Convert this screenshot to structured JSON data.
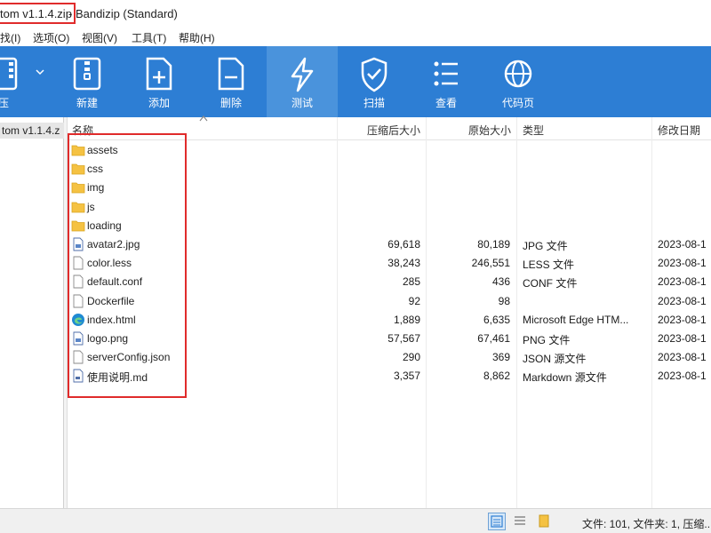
{
  "window": {
    "title_file": "tom v1.1.4.zip",
    "title_app": "- Bandizip (Standard)"
  },
  "menu": [
    {
      "label": "找(I)"
    },
    {
      "label": "选项(O)"
    },
    {
      "label": "视图(V)"
    },
    {
      "label": "工具(T)"
    },
    {
      "label": "帮助(H)"
    }
  ],
  "toolbar": {
    "extract_label": "压",
    "new_label": "新建",
    "add_label": "添加",
    "delete_label": "删除",
    "test_label": "测试",
    "scan_label": "扫描",
    "view_label": "查看",
    "codepage_label": "代码页"
  },
  "tree": {
    "root_label": "tom v1.1.4.z"
  },
  "columns": {
    "name": "名称",
    "compressed": "压缩后大小",
    "original": "原始大小",
    "type": "类型",
    "modified": "修改日期"
  },
  "files": [
    {
      "name": "assets",
      "icon": "folder-icon",
      "compressed": "",
      "original": "",
      "type": "",
      "date": ""
    },
    {
      "name": "css",
      "icon": "folder-icon",
      "compressed": "",
      "original": "",
      "type": "",
      "date": ""
    },
    {
      "name": "img",
      "icon": "folder-icon",
      "compressed": "",
      "original": "",
      "type": "",
      "date": ""
    },
    {
      "name": "js",
      "icon": "folder-icon",
      "compressed": "",
      "original": "",
      "type": "",
      "date": ""
    },
    {
      "name": "loading",
      "icon": "folder-icon",
      "compressed": "",
      "original": "",
      "type": "",
      "date": ""
    },
    {
      "name": "avatar2.jpg",
      "icon": "image-file-icon",
      "compressed": "69,618",
      "original": "80,189",
      "type": "JPG 文件",
      "date": "2023-08-1"
    },
    {
      "name": "color.less",
      "icon": "file-icon",
      "compressed": "38,243",
      "original": "246,551",
      "type": "LESS 文件",
      "date": "2023-08-1"
    },
    {
      "name": "default.conf",
      "icon": "file-icon",
      "compressed": "285",
      "original": "436",
      "type": "CONF 文件",
      "date": "2023-08-1"
    },
    {
      "name": "Dockerfile",
      "icon": "file-icon",
      "compressed": "92",
      "original": "98",
      "type": "",
      "date": "2023-08-1"
    },
    {
      "name": "index.html",
      "icon": "edge-icon",
      "compressed": "1,889",
      "original": "6,635",
      "type": "Microsoft Edge HTM...",
      "date": "2023-08-1"
    },
    {
      "name": "logo.png",
      "icon": "image-file-icon",
      "compressed": "57,567",
      "original": "67,461",
      "type": "PNG 文件",
      "date": "2023-08-1"
    },
    {
      "name": "serverConfig.json",
      "icon": "file-icon",
      "compressed": "290",
      "original": "369",
      "type": "JSON 源文件",
      "date": "2023-08-1"
    },
    {
      "name": "使用说明.md",
      "icon": "text-file-icon",
      "compressed": "3,357",
      "original": "8,862",
      "type": "Markdown 源文件",
      "date": "2023-08-1"
    }
  ],
  "status": {
    "text": "文件: 101, 文件夹: 1, 压缩..."
  },
  "colors": {
    "toolbar": "#2d7ed4",
    "toolbar_active": "#4a93dc",
    "highlight": "#e02b2b",
    "folder": "#f5c242"
  }
}
